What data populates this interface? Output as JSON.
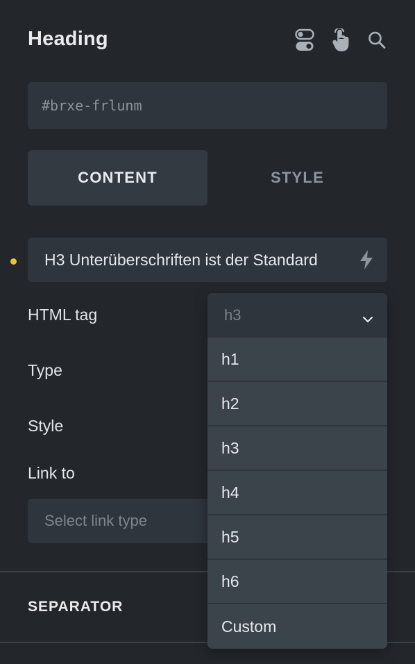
{
  "panel": {
    "title": "Heading",
    "element_id": "#brxe-frlunm"
  },
  "header_icons": [
    "toggle-icon",
    "hand-pointer-icon",
    "search-icon"
  ],
  "tabs": [
    {
      "label": "CONTENT",
      "active": true
    },
    {
      "label": "STYLE",
      "active": false
    }
  ],
  "text_field": {
    "value": "H3 Unterüberschriften ist der Standard",
    "icon": "bolt-icon"
  },
  "fields": {
    "html_tag": "HTML tag",
    "type": "Type",
    "style": "Style",
    "link_to": "Link to"
  },
  "link_select": {
    "placeholder": "Select link type"
  },
  "section": {
    "separator_title": "SEPARATOR"
  },
  "dropdown": {
    "selected": "h3",
    "options": [
      "h1",
      "h2",
      "h3",
      "h4",
      "h5",
      "h6",
      "Custom"
    ]
  },
  "colors": {
    "background": "#23272c",
    "field": "#2f353c",
    "dropdown": "#3b434b",
    "modified_dot": "#f4bf3a"
  }
}
